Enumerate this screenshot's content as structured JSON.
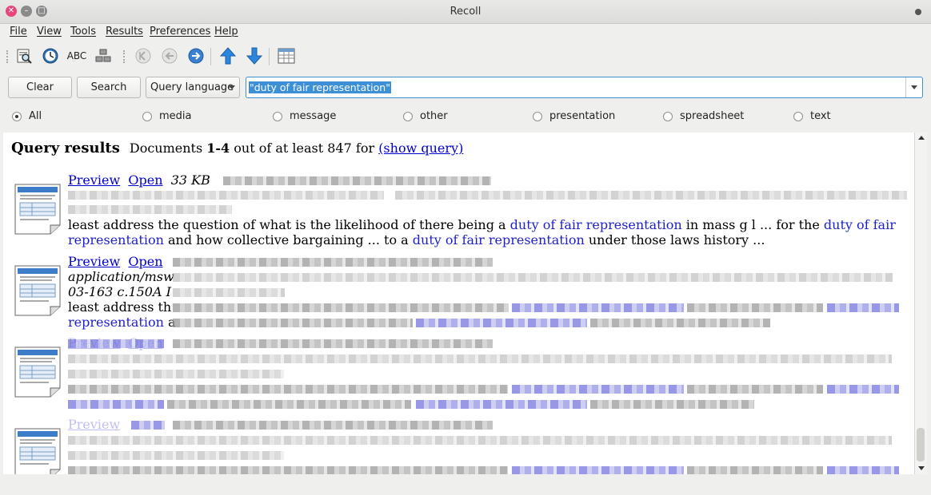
{
  "window": {
    "title": "Recoll"
  },
  "menu": [
    {
      "label": "File"
    },
    {
      "label": "View"
    },
    {
      "label": "Tools"
    },
    {
      "label": "Results"
    },
    {
      "label": "Preferences"
    },
    {
      "label": "Help"
    }
  ],
  "toolbar": {
    "icons": [
      "search-preview-icon",
      "history-clock-icon",
      "spell-check-icon",
      "index-stack-icon",
      "first-page-icon",
      "previous-page-icon",
      "next-page-icon",
      "sort-ascending-icon",
      "sort-descending-icon",
      "table-view-icon"
    ],
    "spell_label": "ABC"
  },
  "search": {
    "clear_label": "Clear",
    "search_label": "Search",
    "mode": "Query language",
    "query": "\"duty of fair representation\""
  },
  "filters": [
    {
      "label": "All",
      "checked": true
    },
    {
      "label": "media",
      "checked": false
    },
    {
      "label": "message",
      "checked": false
    },
    {
      "label": "other",
      "checked": false
    },
    {
      "label": "presentation",
      "checked": false
    },
    {
      "label": "spreadsheet",
      "checked": false
    },
    {
      "label": "text",
      "checked": false
    }
  ],
  "results": {
    "heading": "Query results",
    "docs_prefix": "Documents ",
    "docs_range": "1-4",
    "docs_suffix": " out of at least 847 for ",
    "show_query": "(show query)",
    "items": [
      {
        "preview": "Preview",
        "open": "Open",
        "size": "33 KB",
        "snippet": {
          "t1": "least address the question of what is the likelihood of there being a ",
          "h1": "duty of fair representation",
          "t2": " in mass g l ... for the ",
          "h2": "duty of fair",
          "h3": "representation",
          "t3": " and how collective bargaining ... to a ",
          "h4": "duty of fair representation",
          "t4": " under those laws history ..."
        }
      },
      {
        "preview": "Preview",
        "open": "Open",
        "mime": "application/msw",
        "ref": "03-163 c.150A I",
        "snippet_start": "least address th",
        "hl_start": "representation",
        "hl_tail": " a"
      },
      {
        "preview": "Preview",
        "open": "Open"
      },
      {
        "preview": "Preview"
      }
    ]
  },
  "colors": {
    "link": "#0000cc",
    "highlight": "#1d1fcb",
    "selection": "#3d8fd6",
    "close": "#e8457a"
  }
}
